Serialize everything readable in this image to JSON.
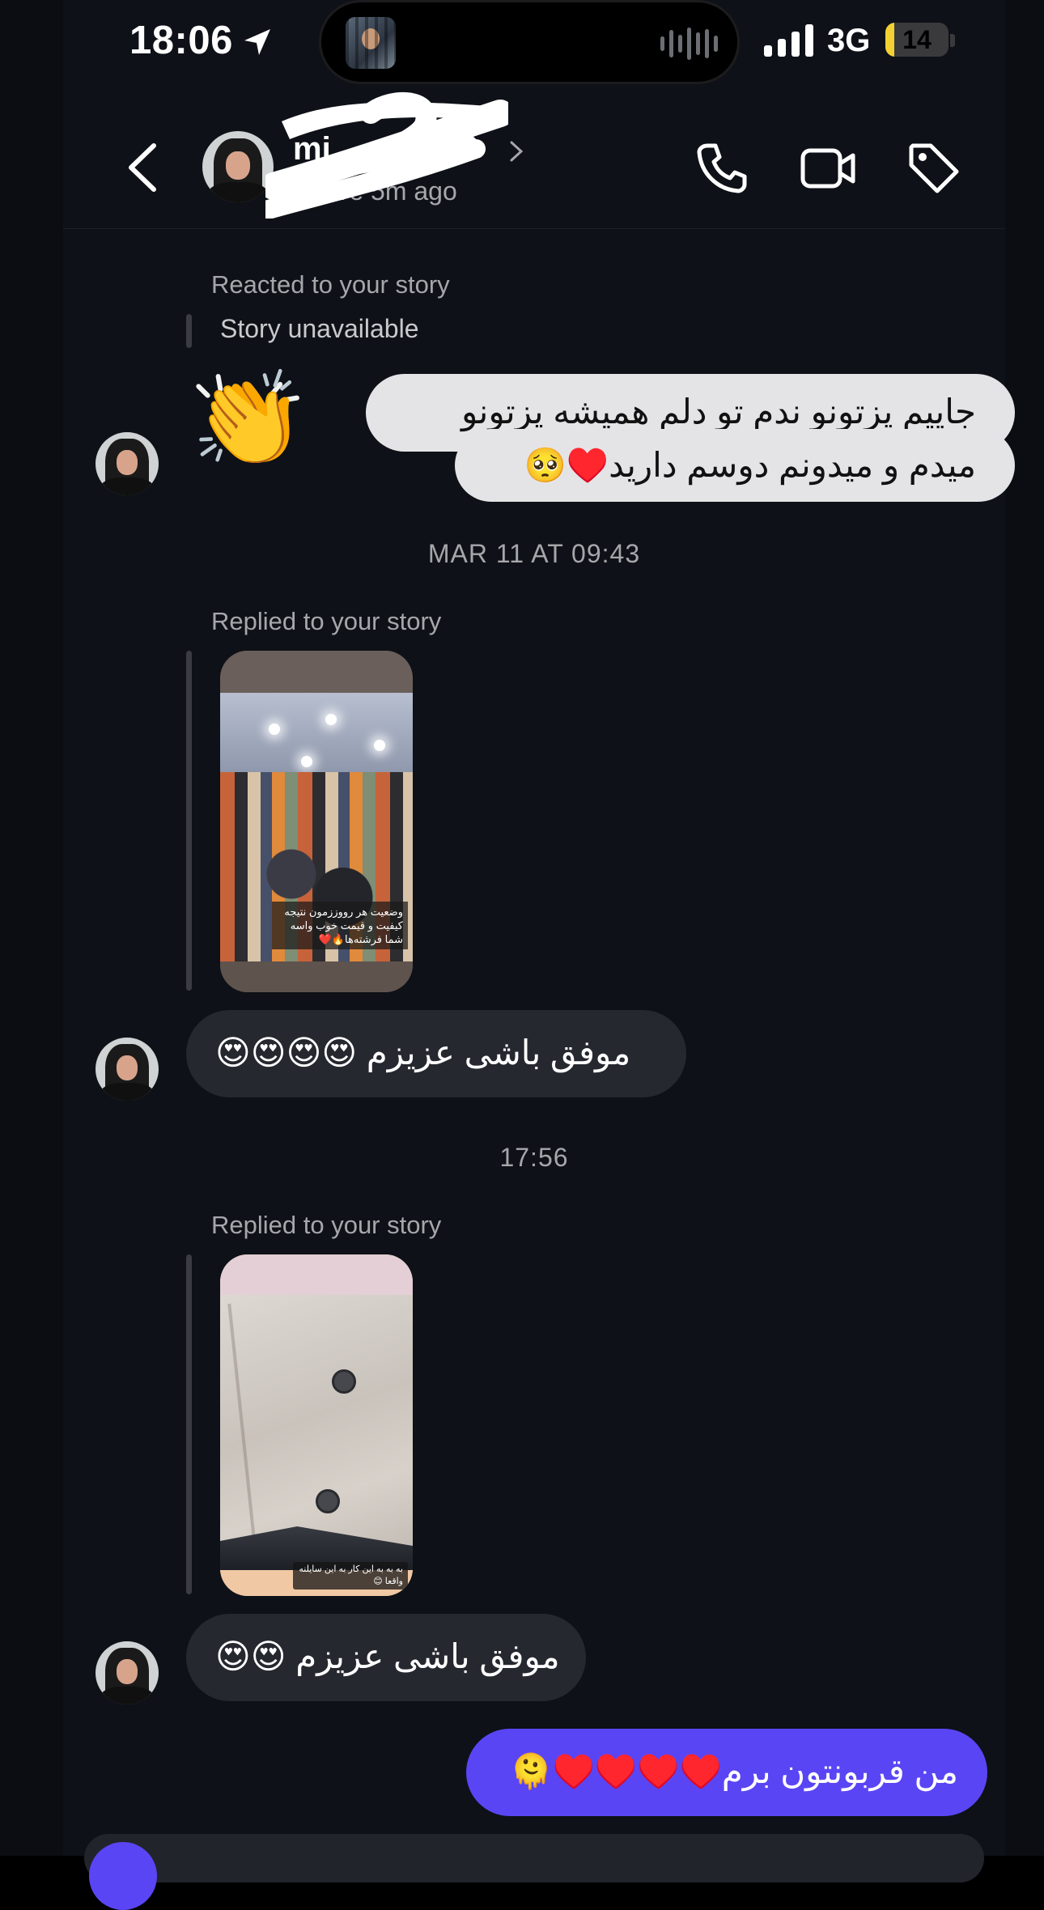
{
  "status_bar": {
    "time": "18:06",
    "network": "3G",
    "battery_level": "14",
    "battery_fraction": 0.14
  },
  "header": {
    "name": "mi",
    "activity": "Active 5m ago"
  },
  "thread": {
    "story_reaction": {
      "context": "Reacted to your story",
      "placeholder": "Story unavailable",
      "reaction": "👏"
    },
    "message_1_line_1": "جاییم پزتونو ندم تو دلم همیشه پزتونو",
    "message_1_line_2": "میدم و میدونم دوسم دارید♥️🥺",
    "timestamp_1": "MAR 11 AT 09:43",
    "reply_1": {
      "context": "Replied to your story",
      "story_caption": "وضعیت هر رووززمون نتیجه کیفیت و قیمت خوب واسه شما فرشته‌ها🔥❤️",
      "message": "موفق باشی عزیزم 😍😍😍😍"
    },
    "timestamp_2": "17:56",
    "reply_2": {
      "context": "Replied to your story",
      "story_caption": "به به به این کار به این سایلنه واقعا 😊",
      "message": "موفق باشی عزیزم 😍😍"
    },
    "outgoing_message": "من قربونتون برم♥️♥️♥️♥️🫠"
  },
  "colors": {
    "background": "#0e1117",
    "outgoing_bubble": "#5a45f5",
    "incoming_bubble": "#262830",
    "light_bubble": "#e4e4e6",
    "muted_text": "#a6a7ab"
  },
  "icons": [
    "location-arrow-icon",
    "signal-icon",
    "battery-icon",
    "back-chevron-icon",
    "phone-icon",
    "video-camera-icon",
    "tag-icon",
    "chevron-right-icon",
    "clap-emoji"
  ]
}
